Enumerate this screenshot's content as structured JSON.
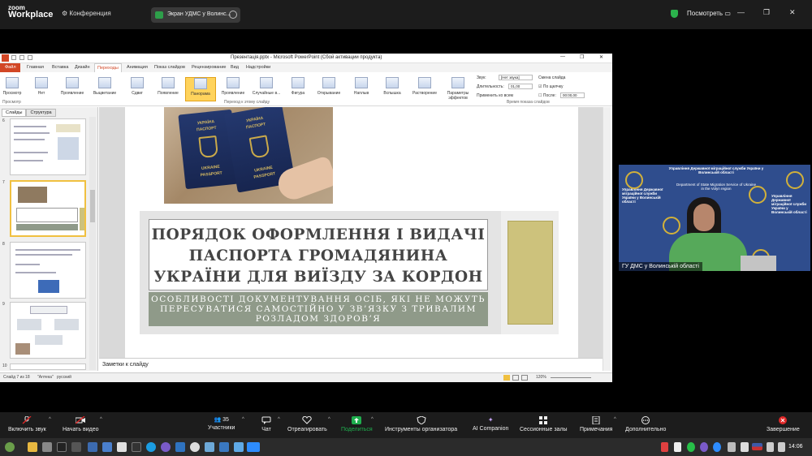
{
  "zoom": {
    "logo_line1": "zoom",
    "logo_line2": "Workplace",
    "conference_label": "Конференция",
    "share_title": "Экран УДМС у Волинс...",
    "view_label": "Посмотреть",
    "toolbar": {
      "mute": "Включить звук",
      "video": "Начать видео",
      "participants": "Участники",
      "participants_count": "35",
      "chat": "Чат",
      "react": "Отреагировать",
      "share": "Поделиться",
      "host_tools": "Инструменты организатора",
      "ai": "AI Companion",
      "breakout": "Сессионные залы",
      "notes": "Примечания",
      "more": "Дополнительно",
      "end": "Завершение"
    },
    "speaker_name": "ГУ ДМС у Волинській області"
  },
  "ppt": {
    "window_title": "Презентація.pptx - Microsoft PowerPoint (Сбой активации продукта)",
    "tabs": {
      "file": "Файл",
      "home": "Главная",
      "insert": "Вставка",
      "design": "Дизайн",
      "transitions": "Переходы",
      "animation": "Анимация",
      "slideshow": "Показ слайдов",
      "review": "Рецензирование",
      "view": "Вид",
      "addins": "Надстройки"
    },
    "ribbon": {
      "preview": "Просмотр",
      "preview_group": "Просмотр",
      "transition_group": "Переход к этому слайду",
      "timing_group": "Время показа слайдов",
      "effects": "Параметры эффектов",
      "items": [
        "Нет",
        "Проявление",
        "Выцветание",
        "Сдвиг",
        "Появление",
        "Панорама",
        "Проявление",
        "Случайные в...",
        "Фигура",
        "Открывание",
        "Наплыв",
        "Вспышка",
        "Растворение"
      ],
      "sound_label": "Звук:",
      "sound_value": "[Нет звука]",
      "duration_label": "Длительность:",
      "duration_value": "01,00",
      "apply_all": "Применить ко всем",
      "change_slide": "Смена слайда",
      "on_click": "По щелчку",
      "after_label": "После:",
      "after_value": "00:00,00"
    },
    "panel_tabs": {
      "slides": "Слайды",
      "outline": "Структура"
    },
    "slide": {
      "title": "ПОРЯДОК ОФОРМЛЕННЯ І ВИДАЧІ ПАСПОРТА ГРОМАДЯНИНА УКРАЇНИ ДЛЯ ВИЇЗДУ ЗА КОРДОН",
      "subtitle": "ОСОБЛИВОСТІ ДОКУМЕНТУВАННЯ ОСІБ, ЯКІ НЕ МОЖУТЬ ПЕРЕСУВАТИСЯ САМОСТІЙНО У ЗВ’ЯЗКУ З ТРИВАЛИМ РОЗЛАДОМ ЗДОРОВ’Я",
      "passport_line1": "УКРАЇНА",
      "passport_line2": "ПАСПОРТ",
      "passport_line3": "UKRAINE",
      "passport_line4": "PASSPORT"
    },
    "thumb_numbers": [
      "6",
      "7",
      "8",
      "9",
      "10"
    ],
    "notes_placeholder": "Заметки к слайду",
    "status_slide": "Слайд 7 из 18",
    "status_theme": "\"Аптека\"",
    "status_lang": "русский",
    "zoom_level": "120%"
  },
  "video": {
    "left_text": "Управління Державної міграційної служби України у Волинській області",
    "top_text": "Управління Державної міграційної служби України у Волинській області",
    "en_text": "Department of State Migration Service of Ukraine in the Volyn region",
    "side_text": "Управління Державної міграційної служби України у Волинській області"
  },
  "taskbar": {
    "time": "14:06"
  }
}
